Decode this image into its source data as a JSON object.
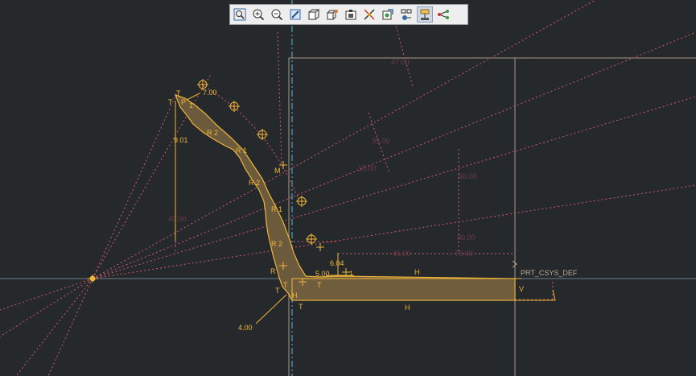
{
  "toolbar": {
    "buttons": [
      {
        "name": "refit-icon",
        "tooltip": "Refit"
      },
      {
        "name": "zoom-in-icon",
        "tooltip": "Zoom In"
      },
      {
        "name": "zoom-out-icon",
        "tooltip": "Zoom Out"
      },
      {
        "name": "repaint-icon",
        "tooltip": "Repaint"
      },
      {
        "name": "display-style-icon",
        "tooltip": "Display Style"
      },
      {
        "name": "saved-orientations-icon",
        "tooltip": "Saved Orientations"
      },
      {
        "name": "sketch-view-icon",
        "tooltip": "Sketch View"
      },
      {
        "name": "datum-display-icon",
        "tooltip": "Datum Display Filters"
      },
      {
        "name": "annotation-display-icon",
        "tooltip": "Annotation Display"
      },
      {
        "name": "sketcher-display-icon",
        "tooltip": "Sketcher Display Filters"
      },
      {
        "name": "constraint-display-icon",
        "tooltip": "Constraint Display",
        "active": true
      },
      {
        "name": "vertex-display-icon",
        "tooltip": "Vertex Display"
      }
    ]
  },
  "sketch": {
    "dimensions": {
      "angle_top": "7.00",
      "side_left": "9.01",
      "small_gap": "6.04",
      "base_small": "5.00",
      "bottom_radius": "4.00"
    },
    "constraints": {
      "T": "T",
      "R": "R",
      "R1": "R 1",
      "R2": "R 2",
      "H": "H",
      "V": "V",
      "M": "M",
      "L1": "1",
      "P": "P",
      "1": "1"
    },
    "csys_label": "PRT_CSYS_DEF",
    "hidden_dims": [
      "47.00",
      "35.00",
      "60.00",
      "40.00",
      "15.00",
      "45.00",
      "70.00",
      "30.00"
    ]
  },
  "colors": {
    "background": "#25292c",
    "profile_fill": "#6b5a3c",
    "profile_line": "#f0b53a",
    "construction": "#d0586a",
    "centerline": "#58b8d8",
    "frame": "#bfa995"
  }
}
